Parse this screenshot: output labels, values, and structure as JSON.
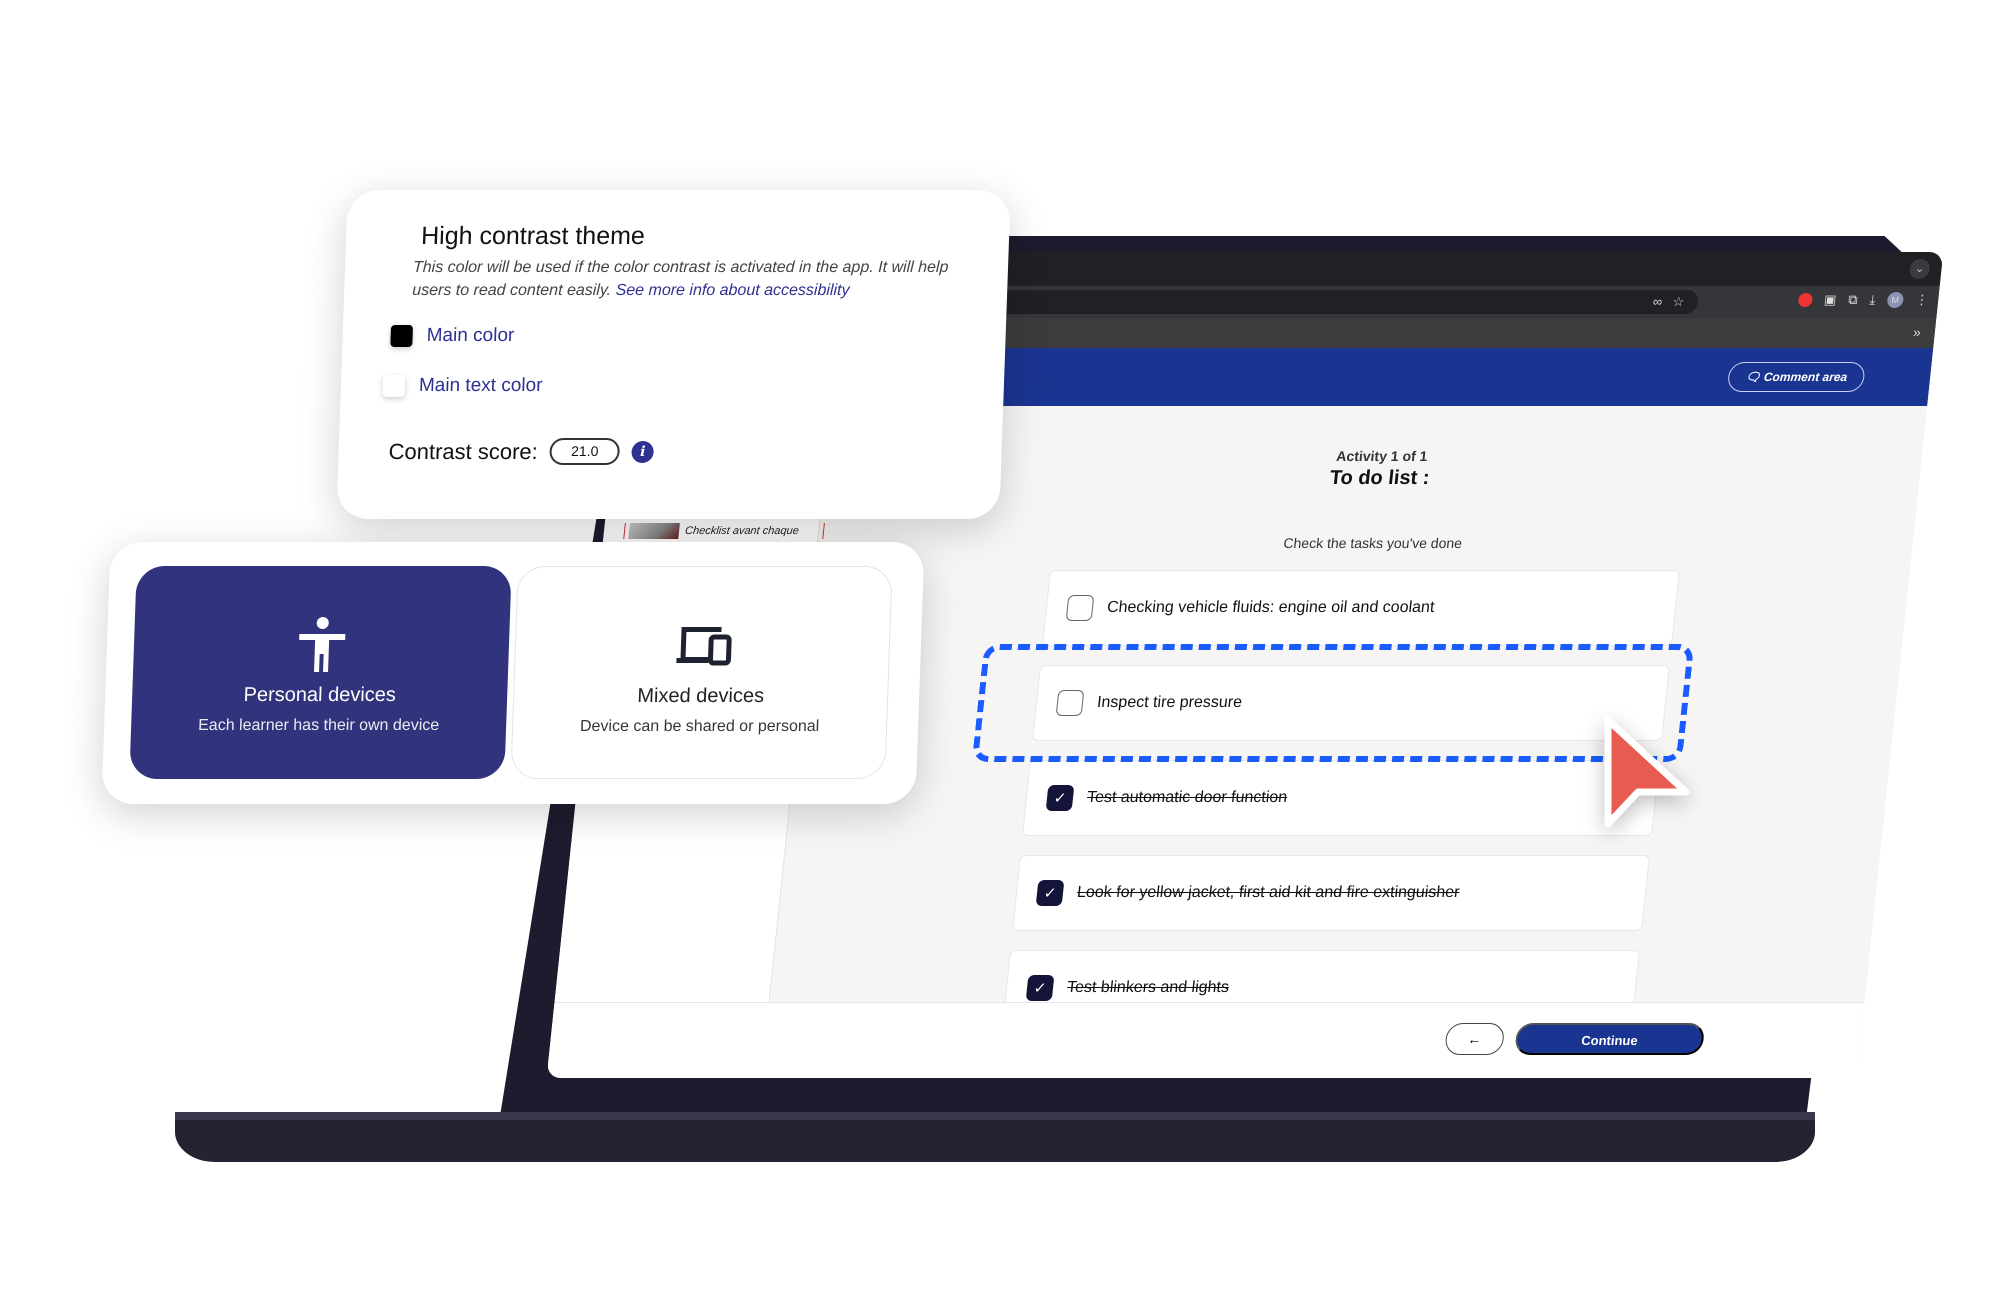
{
  "browser": {
    "bookmarks_overflow": "»",
    "collapse": "⌄",
    "toolbar_icons": [
      "incognito-icon",
      "star-icon",
      "adblock-icon",
      "tab-icon",
      "extensions-icon",
      "download-icon",
      "avatar-icon",
      "menu-icon"
    ],
    "avatar_letter": "M"
  },
  "header": {
    "comment_label": "Comment area"
  },
  "sidebar": {
    "thumbnail_label": "Checklist avant chaque"
  },
  "main": {
    "activity": "Activity 1 of 1",
    "title": "To do list :",
    "instruction": "Check the tasks you've done",
    "tasks": [
      {
        "label": "Checking vehicle fluids: engine oil and coolant",
        "checked": false
      },
      {
        "label": "Inspect tire pressure",
        "checked": false
      },
      {
        "label": "Test automatic door function",
        "checked": true
      },
      {
        "label": "Look for yellow jacket, first aid kit and fire extinguisher",
        "checked": true
      },
      {
        "label": "Test blinkers and lights",
        "checked": true
      }
    ]
  },
  "footer": {
    "back_label": "←",
    "continue_label": "Continue"
  },
  "contrast_card": {
    "title": "High contrast theme",
    "description": "This color will be used if the color contrast is activated in the app. It will help users to read content easily.",
    "link": "See more info about accessibility",
    "main_color_label": "Main color",
    "main_color": "#000000",
    "main_text_color_label": "Main text color",
    "main_text_color": "#ffffff",
    "score_label": "Contrast score:",
    "score": "21.0",
    "info": "i"
  },
  "device_card": {
    "options": [
      {
        "title": "Personal devices",
        "subtitle": "Each learner has their own device",
        "selected": true,
        "icon": "accessibility-person-icon"
      },
      {
        "title": "Mixed devices",
        "subtitle": "Device can be shared or personal",
        "selected": false,
        "icon": "laptop-phone-icon"
      }
    ]
  },
  "colors": {
    "brand_blue": "#1a3491",
    "tile_selected": "#31347c",
    "highlight": "#1a5cff",
    "cursor": "#e85b50"
  }
}
